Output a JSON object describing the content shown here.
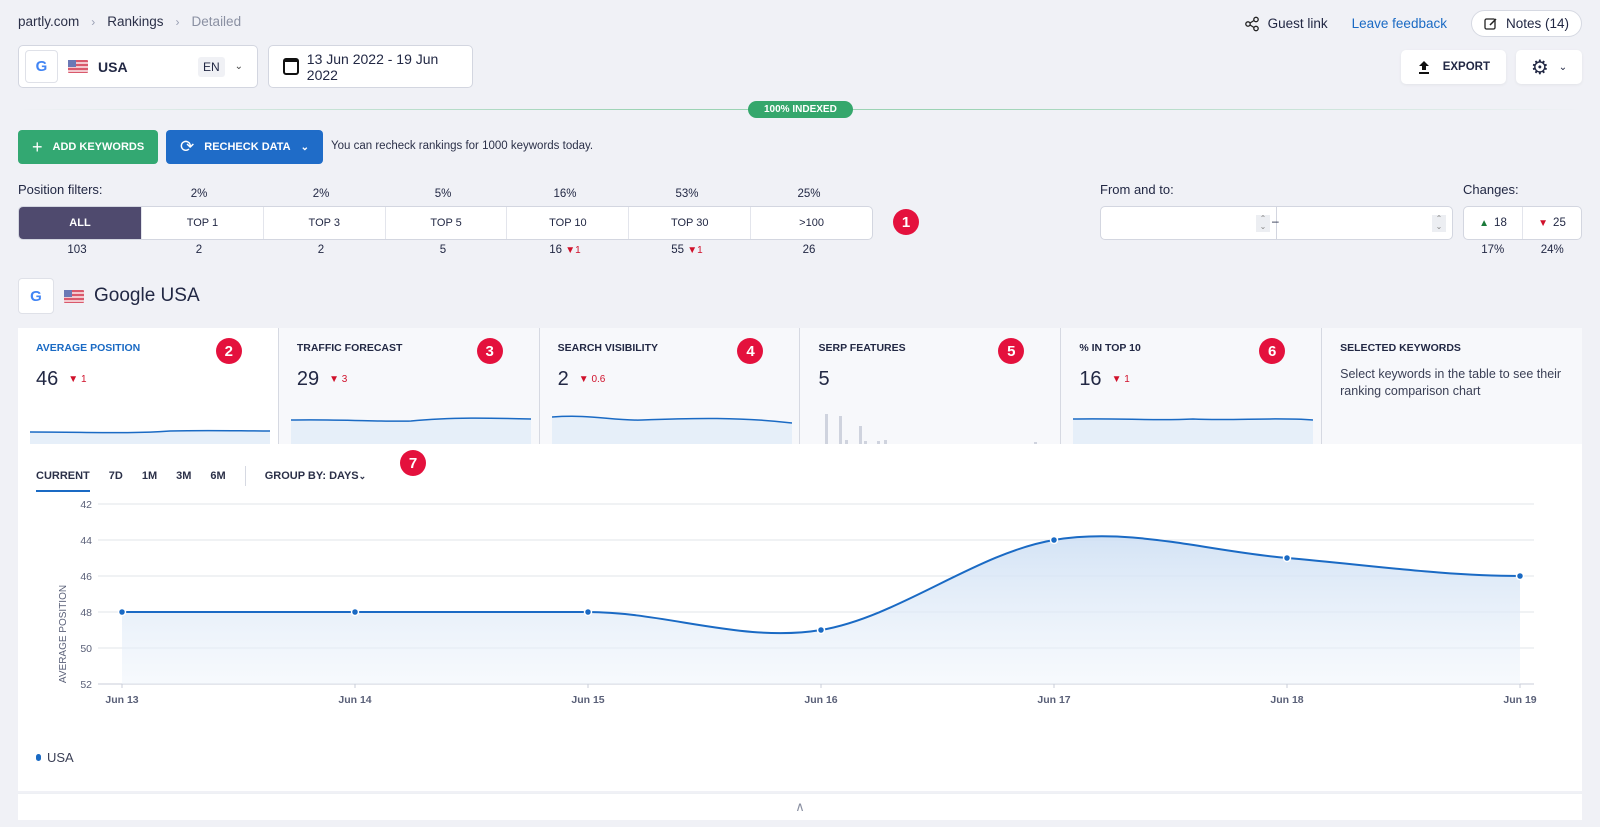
{
  "breadcrumb": [
    "partly.com",
    "Rankings",
    "Detailed"
  ],
  "topbar": {
    "guest_link": "Guest link",
    "leave_feedback": "Leave feedback",
    "notes": "Notes (14)",
    "export": "EXPORT"
  },
  "selector": {
    "engine": "G",
    "country": "USA",
    "language": "EN"
  },
  "date_range": "13 Jun 2022 - 19 Jun 2022",
  "indexed_badge": "100% INDEXED",
  "actions": {
    "add_keywords": "ADD KEYWORDS",
    "recheck_data": "RECHECK DATA",
    "recheck_note": "You can recheck rankings for 1000 keywords today."
  },
  "position_filters": {
    "label": "Position filters:",
    "items": [
      {
        "label": "ALL",
        "percent": "",
        "count": "103",
        "change": ""
      },
      {
        "label": "TOP 1",
        "percent": "2%",
        "count": "2",
        "change": ""
      },
      {
        "label": "TOP 3",
        "percent": "2%",
        "count": "2",
        "change": ""
      },
      {
        "label": "TOP 5",
        "percent": "5%",
        "count": "5",
        "change": ""
      },
      {
        "label": "TOP 10",
        "percent": "16%",
        "count": "16",
        "change": "1"
      },
      {
        "label": "TOP 30",
        "percent": "53%",
        "count": "55",
        "change": "1"
      },
      {
        "label": ">100",
        "percent": "25%",
        "count": "26",
        "change": ""
      }
    ]
  },
  "from_to": {
    "label": "From and to:",
    "from": "",
    "to": ""
  },
  "changes": {
    "label": "Changes:",
    "up": "18",
    "down": "25",
    "up_pct": "17%",
    "down_pct": "24%"
  },
  "engine_title": "Google USA",
  "badges": [
    "1",
    "2",
    "3",
    "4",
    "5",
    "6",
    "7"
  ],
  "metrics": [
    {
      "title": "AVERAGE POSITION",
      "value": "46",
      "change": "1"
    },
    {
      "title": "TRAFFIC FORECAST",
      "value": "29",
      "change": "3"
    },
    {
      "title": "SEARCH VISIBILITY",
      "value": "2",
      "change": "0.6"
    },
    {
      "title": "SERP FEATURES",
      "value": "5",
      "change": ""
    },
    {
      "title": "% IN TOP 10",
      "value": "16",
      "change": "1"
    },
    {
      "title": "SELECTED KEYWORDS",
      "description": "Select keywords in the table to see their ranking comparison chart"
    }
  ],
  "chart_controls": {
    "ranges": [
      "CURRENT",
      "7D",
      "1M",
      "3M",
      "6M"
    ],
    "active_range": "CURRENT",
    "group_by_label": "GROUP BY:",
    "group_by_value": "DAYS"
  },
  "colors": {
    "accent": "#1a6ac4",
    "green": "#33a872",
    "danger": "#e4113d",
    "filter_active": "#4f4a6e"
  },
  "chart_data": {
    "type": "area",
    "title": "",
    "xlabel": "",
    "ylabel": "AVERAGE POSITION",
    "categories": [
      "Jun 13",
      "Jun 14",
      "Jun 15",
      "Jun 16",
      "Jun 17",
      "Jun 18",
      "Jun 19"
    ],
    "series": [
      {
        "name": "USA",
        "values": [
          48,
          48,
          48,
          49,
          44,
          45,
          46
        ]
      }
    ],
    "yticks": [
      42,
      44,
      46,
      48,
      50,
      52
    ],
    "ylim": [
      42,
      52
    ],
    "y_inverted": true,
    "grid": true,
    "legend": "bottom-left"
  }
}
